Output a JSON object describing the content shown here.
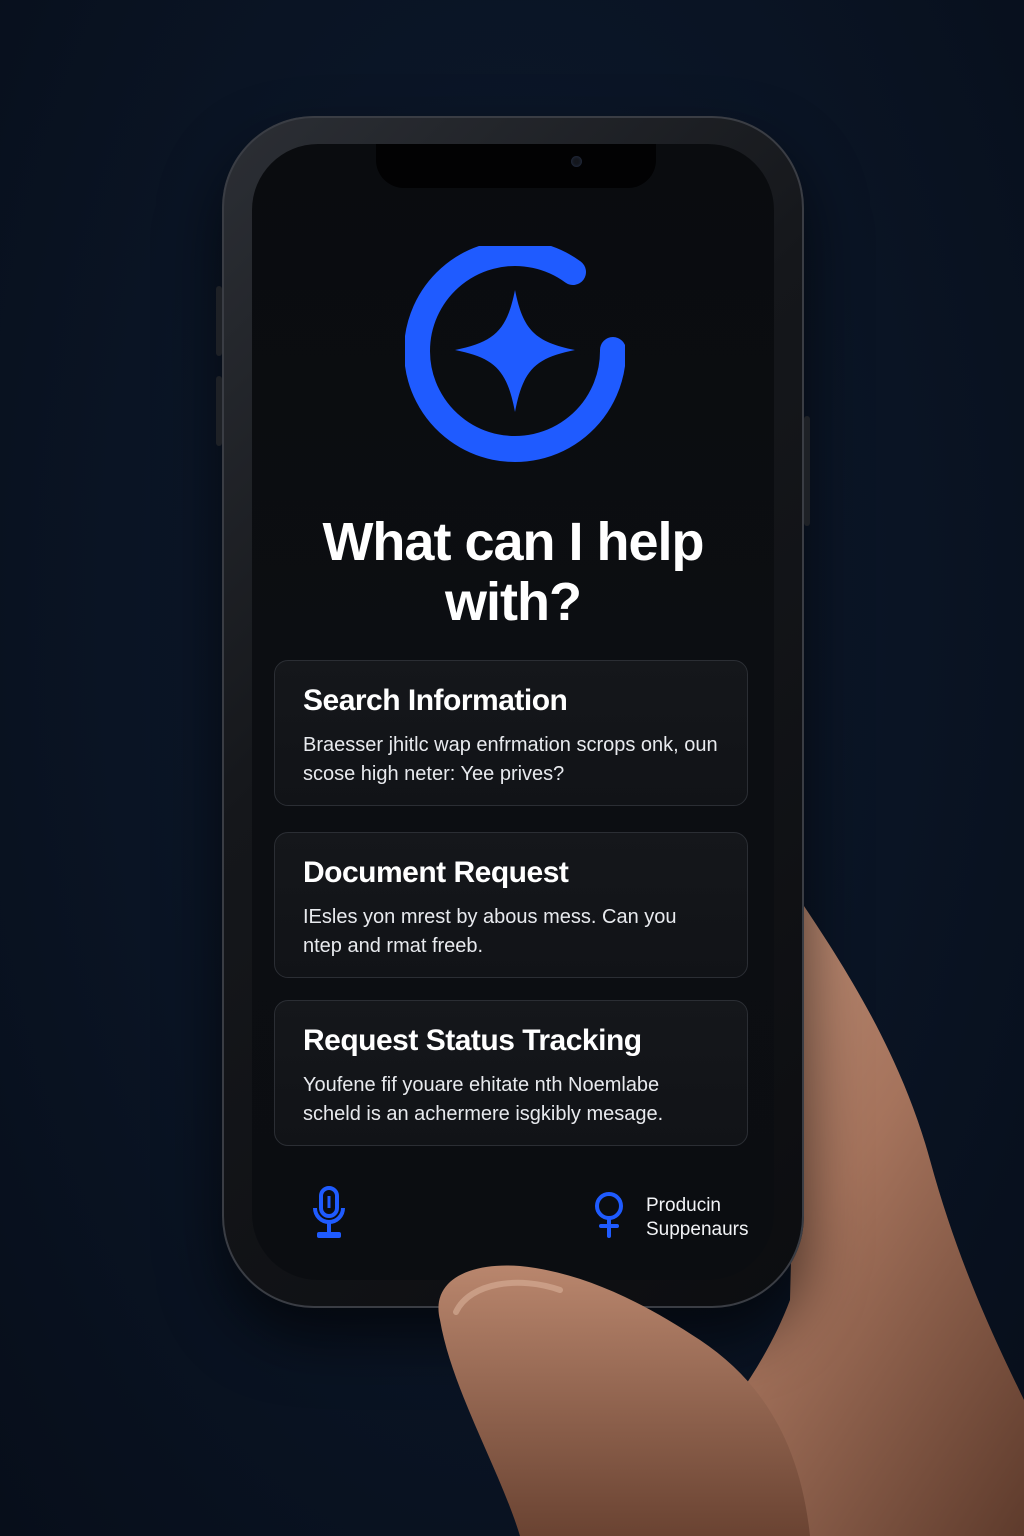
{
  "colors": {
    "accent": "#1f5bff",
    "background": "#0a1424",
    "screen": "#0b0d11",
    "card": "#131519",
    "text": "#ffffff"
  },
  "logo": {
    "icon": "ring-sparkle-logo"
  },
  "headline": "What can I help with?",
  "cards": [
    {
      "title": "Search Information",
      "body": "Braesser jhitlc wap enfrmation scrops onk, oun scose high neter: Yee prives?"
    },
    {
      "title": "Document Request",
      "body": "IEsles yon mrest by abous mess. Can you ntep and rmat freeb."
    },
    {
      "title": "Request Status Tracking",
      "body": "Youfene fif youare ehitate nth Noemlabe scheld is an achermere isgkibly mesage."
    }
  ],
  "bottom_bar": {
    "mic_icon": "microphone-icon",
    "support_icon": "support-person-icon",
    "support_label": "Producin Suppenaurs"
  }
}
